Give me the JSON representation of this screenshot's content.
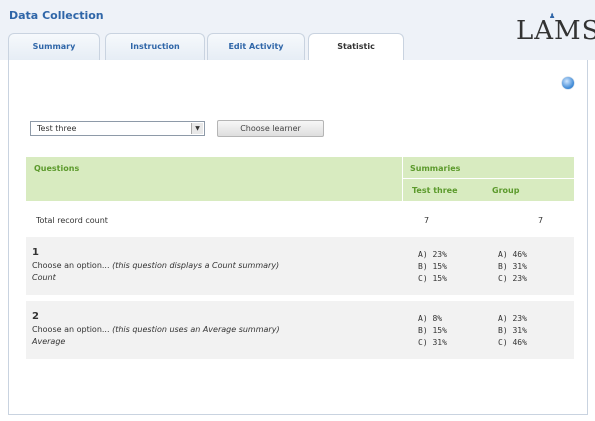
{
  "app": {
    "title": "Data Collection",
    "logo": "LAMS"
  },
  "tabs": [
    {
      "label": "Summary"
    },
    {
      "label": "Instruction"
    },
    {
      "label": "Edit Activity"
    },
    {
      "label": "Statistic"
    }
  ],
  "active_tab": "Statistic",
  "controls": {
    "learner_select_value": "Test three",
    "choose_learner_label": "Choose learner"
  },
  "table": {
    "questions_header": "Questions",
    "summaries_header": "Summaries",
    "col_learner": "Test three",
    "col_group": "Group",
    "total_label": "Total record count",
    "total_learner": "7",
    "total_group": "7",
    "questions": [
      {
        "number": "1",
        "text": "Choose an option...",
        "note": "(this question displays a Count summary)",
        "type": "Count",
        "learner": [
          "A) 23%",
          "B) 15%",
          "C) 15%"
        ],
        "group": [
          "A) 46%",
          "B) 31%",
          "C) 23%"
        ]
      },
      {
        "number": "2",
        "text": "Choose an option...",
        "note": "(this question uses an Average summary)",
        "type": "Average",
        "learner": [
          "A) 8%",
          "B) 15%",
          "C) 31%"
        ],
        "group": [
          "A) 23%",
          "B) 31%",
          "C) 46%"
        ]
      }
    ]
  }
}
